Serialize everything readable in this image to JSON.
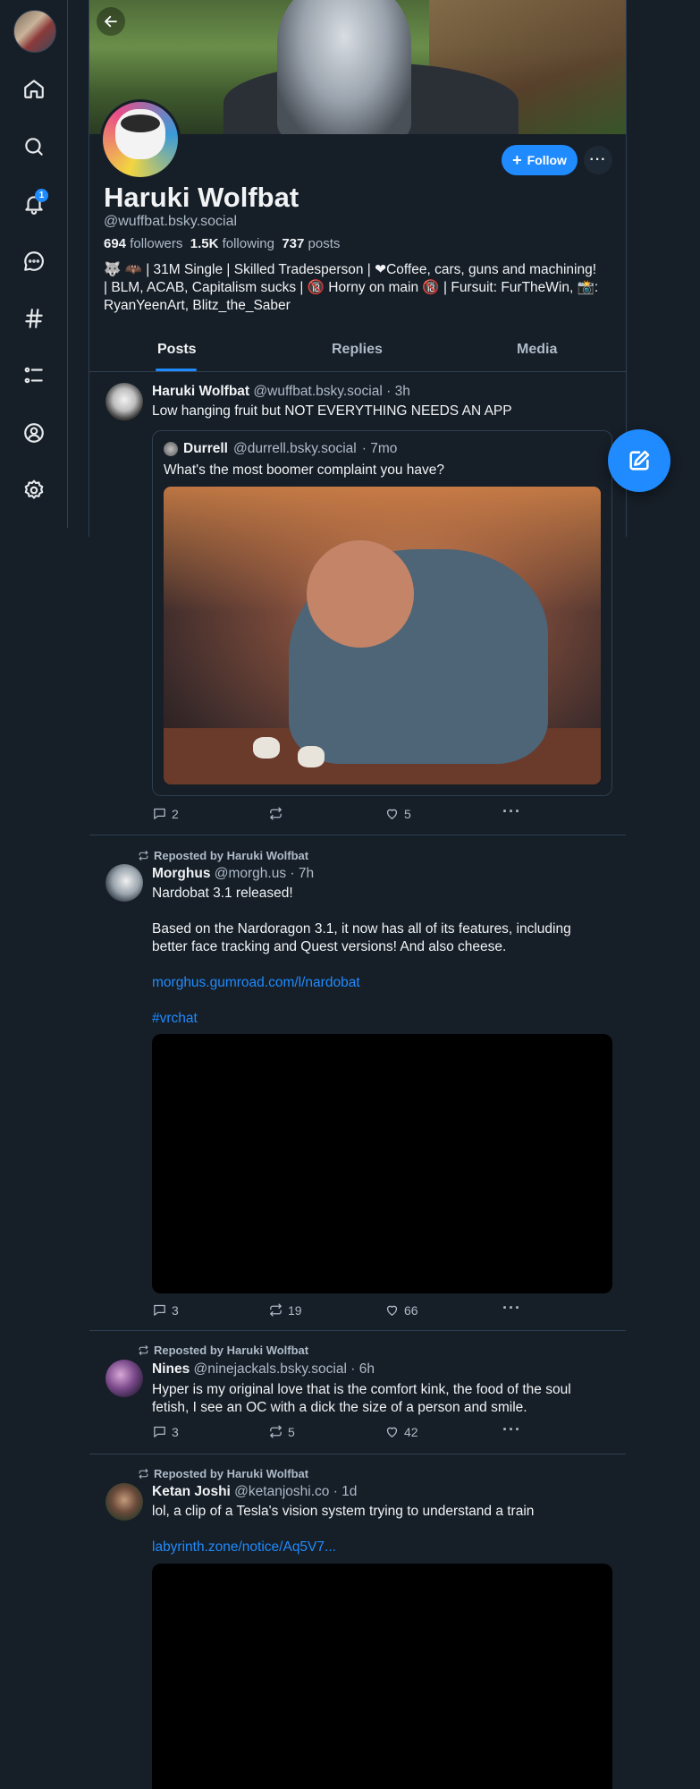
{
  "sidebar": {
    "notification_badge": "1",
    "items": [
      {
        "name": "home-icon"
      },
      {
        "name": "search-icon"
      },
      {
        "name": "bell-icon"
      },
      {
        "name": "chat-icon"
      },
      {
        "name": "hashtag-icon"
      },
      {
        "name": "lists-icon"
      },
      {
        "name": "profile-icon"
      },
      {
        "name": "settings-icon"
      }
    ]
  },
  "profile": {
    "follow_label": "Follow",
    "more_label": "···",
    "display_name": "Haruki Wolfbat",
    "handle": "@wuffbat.bsky.social",
    "followers_count": "694",
    "followers_label": "followers",
    "following_count": "1.5K",
    "following_label": "following",
    "posts_count": "737",
    "posts_label": "posts",
    "bio_line1": "🐺 🦇 | 31M Single | Skilled Tradesperson | ❤Coffee, cars, guns and machining!",
    "bio_line2": "| BLM, ACAB, Capitalism sucks | 🔞 Horny on main 🔞 | Fursuit: FurTheWin, 📸:",
    "bio_line3": "RyanYeenArt,  Blitz_the_Saber"
  },
  "tabs": [
    "Posts",
    "Replies",
    "Media"
  ],
  "colors": {
    "accent": "#208bfe",
    "background": "#161e27",
    "border": "#2e4052",
    "muted": "#aebbc9"
  },
  "posts": [
    {
      "author": "Haruki Wolfbat",
      "handle": "@wuffbat.bsky.social",
      "time": "· 3h",
      "text": "Low hanging fruit but NOT EVERYTHING NEEDS AN APP",
      "quote": {
        "author": "Durrell",
        "handle": "@durrell.bsky.social",
        "time": "· 7mo",
        "text": "What's the most boomer complaint you have?"
      },
      "replies": "2",
      "reposts": "",
      "likes": "5"
    },
    {
      "reposted_by": "Reposted by Haruki Wolfbat",
      "author": "Morghus",
      "handle": "@morgh.us",
      "time": "· 7h",
      "text_line1": "Nardobat 3.1 released!",
      "text_line2": "Based on the Nardoragon 3.1, it now has all of its features, including",
      "text_line3": "better face tracking and Quest versions! And also cheese.",
      "link": "morghus.gumroad.com/l/nardobat",
      "hashtag": "#vrchat",
      "replies": "3",
      "reposts": "19",
      "likes": "66"
    },
    {
      "reposted_by": "Reposted by Haruki Wolfbat",
      "author": "Nines",
      "handle": "@ninejackals.bsky.social",
      "time": "· 6h",
      "text_line1": "Hyper is my original love that is the comfort kink, the food of the soul",
      "text_line2": "fetish, I see an OC with a dick the size of a person and smile.",
      "replies": "3",
      "reposts": "5",
      "likes": "42"
    },
    {
      "reposted_by": "Reposted by Haruki Wolfbat",
      "author": "Ketan Joshi",
      "handle": "@ketanjoshi.co",
      "time": "· 1d",
      "text": "lol, a clip of a Tesla's vision system trying to understand a train",
      "link": "labyrinth.zone/notice/Aq5V7..."
    }
  ]
}
